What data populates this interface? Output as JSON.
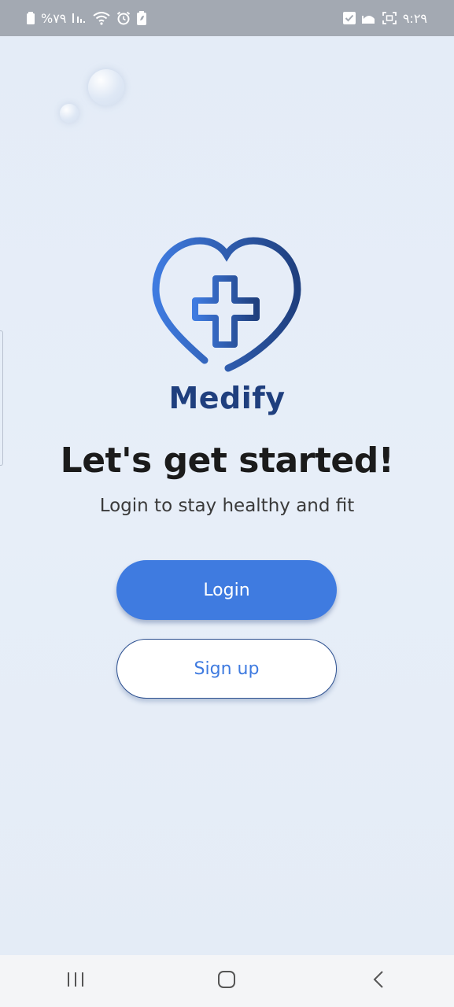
{
  "status_bar": {
    "battery_text": "%۷۹",
    "time": "۹:۲۹"
  },
  "app": {
    "brand_name": "Medify",
    "brand_color": "#1f3f7e",
    "accent_color": "#3f7be0"
  },
  "welcome": {
    "headline": "Let's get started!",
    "subtitle": "Login to stay healthy and fit"
  },
  "actions": {
    "login_label": "Login",
    "signup_label": "Sign up"
  },
  "nav_bar": {
    "recents_icon": "recents-icon",
    "home_icon": "home-icon",
    "back_icon": "back-icon"
  }
}
